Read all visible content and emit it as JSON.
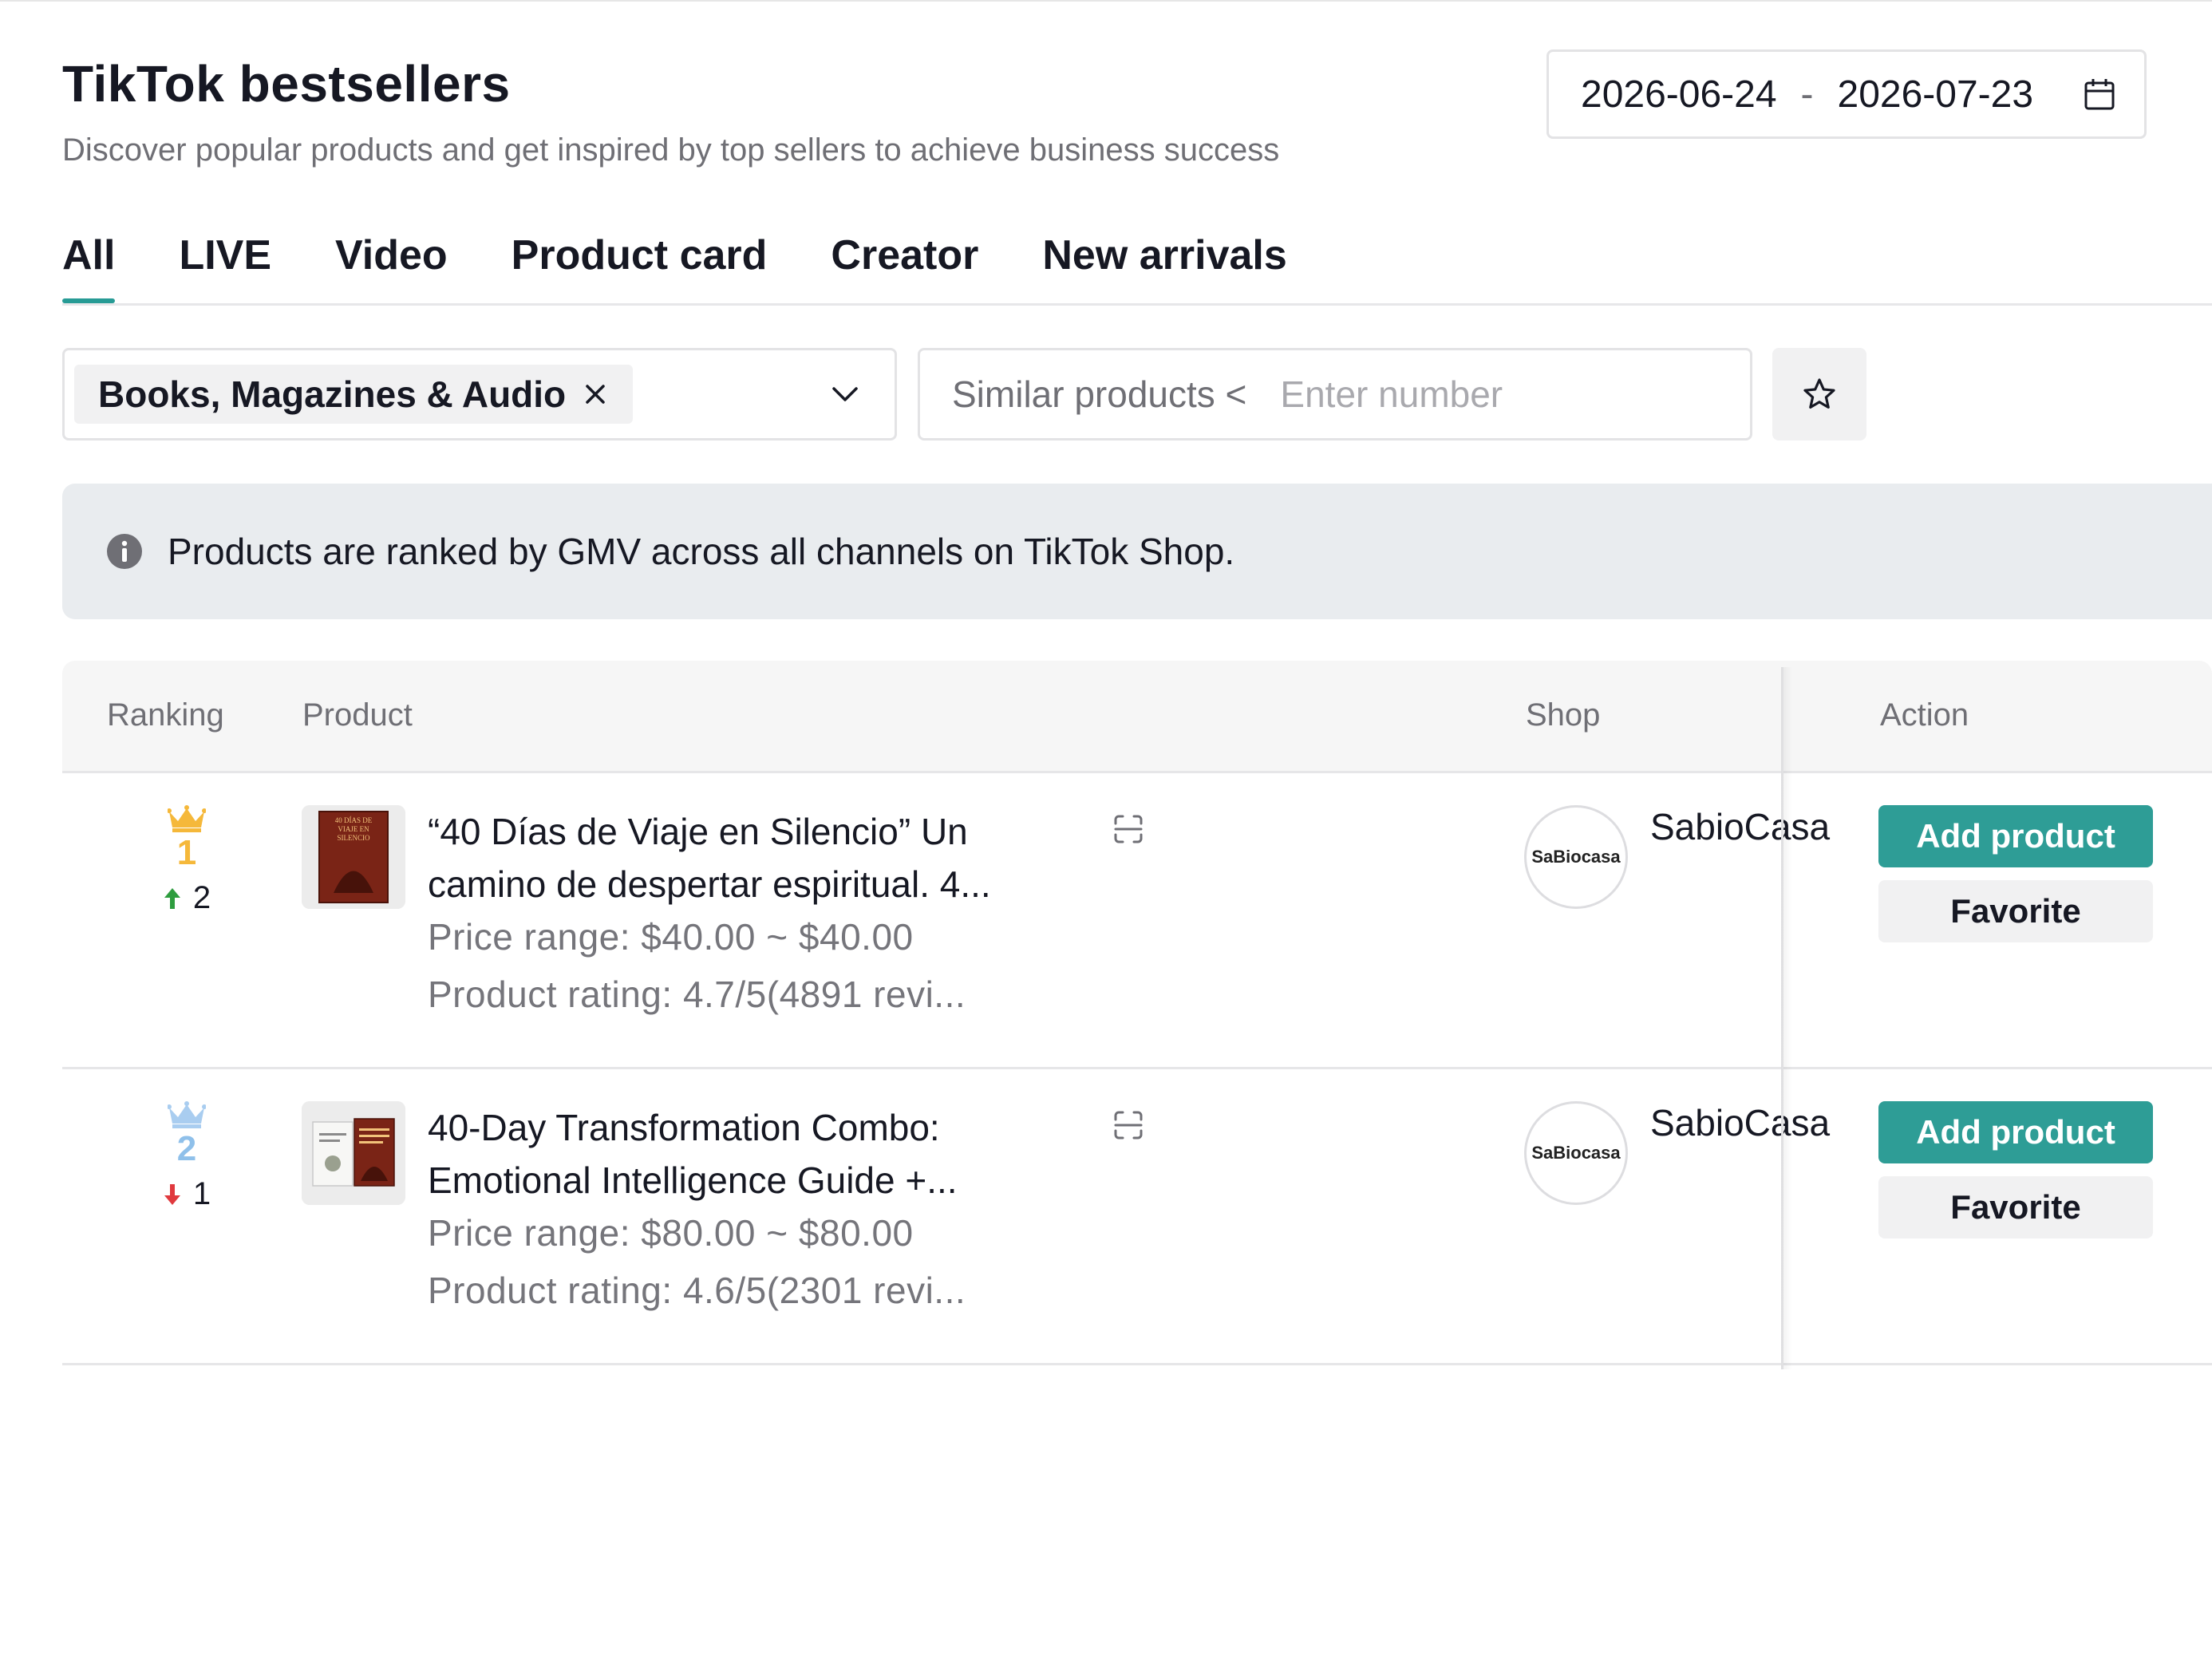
{
  "header": {
    "title": "TikTok bestsellers",
    "subtitle": "Discover popular products and get inspired by top sellers to achieve business success"
  },
  "date_range": {
    "start": "2026-06-24",
    "separator": "-",
    "end": "2026-07-23",
    "icon": "calendar-icon"
  },
  "tabs": [
    {
      "label": "All",
      "active": true
    },
    {
      "label": "LIVE",
      "active": false
    },
    {
      "label": "Video",
      "active": false
    },
    {
      "label": "Product card",
      "active": false
    },
    {
      "label": "Creator",
      "active": false
    },
    {
      "label": "New arrivals",
      "active": false
    }
  ],
  "filters": {
    "category_chip": "Books, Magazines & Audio",
    "similar_label": "Similar products <",
    "similar_placeholder": "Enter number"
  },
  "notice": {
    "text": "Products are ranked by GMV across all channels on TikTok Shop.",
    "icon": "info-icon"
  },
  "table": {
    "columns": {
      "ranking": "Ranking",
      "product": "Product",
      "shop": "Shop",
      "action": "Action"
    },
    "rows": [
      {
        "rank": "1",
        "rank_change": "2",
        "rank_direction": "up",
        "title_line1": "“40 Días de Viaje en Silencio” Un",
        "title_line2": "camino de despertar espiritual. 4...",
        "price": "Price range: $40.00 ~ $40.00",
        "rating": "Product rating: 4.7/5(4891 revi...",
        "shop_name": "SabioCasa",
        "shop_logo_text": "SaBiocasa",
        "add_label": "Add product",
        "fav_label": "Favorite"
      },
      {
        "rank": "2",
        "rank_change": "1",
        "rank_direction": "down",
        "title_line1": "40-Day Transformation Combo:",
        "title_line2": "Emotional Intelligence Guide +...",
        "price": "Price range: $80.00 ~ $80.00",
        "rating": "Product rating: 4.6/5(2301 revi...",
        "shop_name": "SabioCasa",
        "shop_logo_text": "SaBiocasa",
        "add_label": "Add product",
        "fav_label": "Favorite"
      }
    ]
  },
  "colors": {
    "accent": "#279b95",
    "button": "#2e9d96",
    "up": "#2e9d3f",
    "down": "#e0393e",
    "gold": "#f5b83a",
    "silver": "#8fc0ea"
  }
}
